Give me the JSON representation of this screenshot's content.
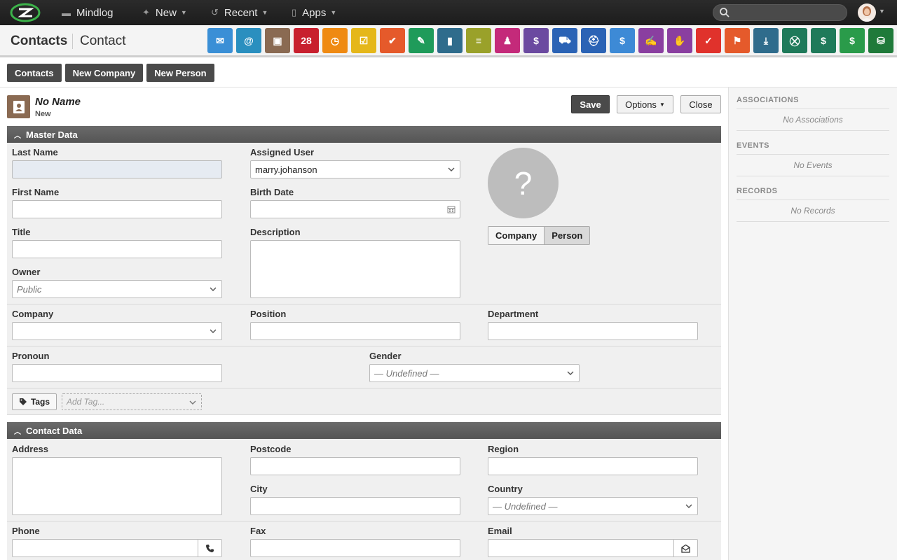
{
  "topbar": {
    "app_name": "Mindlog",
    "new_label": "New",
    "recent_label": "Recent",
    "apps_label": "Apps",
    "search_placeholder": ""
  },
  "header": {
    "title": "Contacts",
    "subtitle": "Contact",
    "apps": [
      {
        "name": "mail-icon",
        "color": "#3a8fd6",
        "glyph": "✉"
      },
      {
        "name": "address-book-icon",
        "color": "#2a8fbf",
        "glyph": "@"
      },
      {
        "name": "contacts-icon",
        "color": "#8a6a52",
        "glyph": "▣"
      },
      {
        "name": "calendar-icon",
        "color": "#c8202e",
        "glyph": "28"
      },
      {
        "name": "timer-icon",
        "color": "#ef8a12",
        "glyph": "◷"
      },
      {
        "name": "tasks-icon",
        "color": "#e5b71a",
        "glyph": "☑"
      },
      {
        "name": "projects-icon",
        "color": "#e55a2b",
        "glyph": "✔"
      },
      {
        "name": "notes-icon",
        "color": "#1f9b5a",
        "glyph": "✎"
      },
      {
        "name": "bookmarks-icon",
        "color": "#2f6c8c",
        "glyph": "▮"
      },
      {
        "name": "documents-icon",
        "color": "#9aa12a",
        "glyph": "≡"
      },
      {
        "name": "helpdesk-icon",
        "color": "#c42a7a",
        "glyph": "♟"
      },
      {
        "name": "sales-icon",
        "color": "#6b4aa0",
        "glyph": "$"
      },
      {
        "name": "delivery-icon",
        "color": "#2b63b5",
        "glyph": "⛟"
      },
      {
        "name": "support-icon",
        "color": "#2b63b5",
        "glyph": "⛑"
      },
      {
        "name": "finance-icon",
        "color": "#3d8ad6",
        "glyph": "$"
      },
      {
        "name": "contracts-icon",
        "color": "#8a3fa0",
        "glyph": "✍"
      },
      {
        "name": "deals-icon",
        "color": "#8a3fa0",
        "glyph": "✋"
      },
      {
        "name": "pdf-icon",
        "color": "#e0322c",
        "glyph": "✓"
      },
      {
        "name": "broadcast-icon",
        "color": "#e55a2b",
        "glyph": "⚑"
      },
      {
        "name": "download-icon",
        "color": "#2f6c8c",
        "glyph": "⤓"
      },
      {
        "name": "purchasing-icon",
        "color": "#1f7a5a",
        "glyph": "⛒"
      },
      {
        "name": "billing-icon",
        "color": "#1f7a5a",
        "glyph": "$"
      },
      {
        "name": "pricing-icon",
        "color": "#2a9b4a",
        "glyph": "$"
      },
      {
        "name": "database-icon",
        "color": "#1f7a3a",
        "glyph": "⛁"
      }
    ]
  },
  "actions": {
    "contacts": "Contacts",
    "new_company": "New Company",
    "new_person": "New Person"
  },
  "record": {
    "name": "No Name",
    "state": "New",
    "save": "Save",
    "options": "Options",
    "close": "Close"
  },
  "master": {
    "section_title": "Master Data",
    "last_name_label": "Last Name",
    "first_name_label": "First Name",
    "title_label": "Title",
    "owner_label": "Owner",
    "owner_value": "Public",
    "assigned_user_label": "Assigned User",
    "assigned_user_value": "marry.johanson",
    "birth_date_label": "Birth Date",
    "description_label": "Description",
    "photo_placeholder": "?",
    "type_company": "Company",
    "type_person": "Person",
    "company_label": "Company",
    "position_label": "Position",
    "department_label": "Department",
    "pronoun_label": "Pronoun",
    "gender_label": "Gender",
    "gender_value": "— Undefined —",
    "tags_label": "Tags",
    "add_tag_placeholder": "Add Tag..."
  },
  "contact": {
    "section_title": "Contact Data",
    "address_label": "Address",
    "postcode_label": "Postcode",
    "city_label": "City",
    "region_label": "Region",
    "country_label": "Country",
    "country_value": "— Undefined —",
    "phone_label": "Phone",
    "fax_label": "Fax",
    "email_label": "Email"
  },
  "sidebar": {
    "associations_title": "ASSOCIATIONS",
    "associations_empty": "No Associations",
    "events_title": "EVENTS",
    "events_empty": "No Events",
    "records_title": "RECORDS",
    "records_empty": "No Records"
  }
}
